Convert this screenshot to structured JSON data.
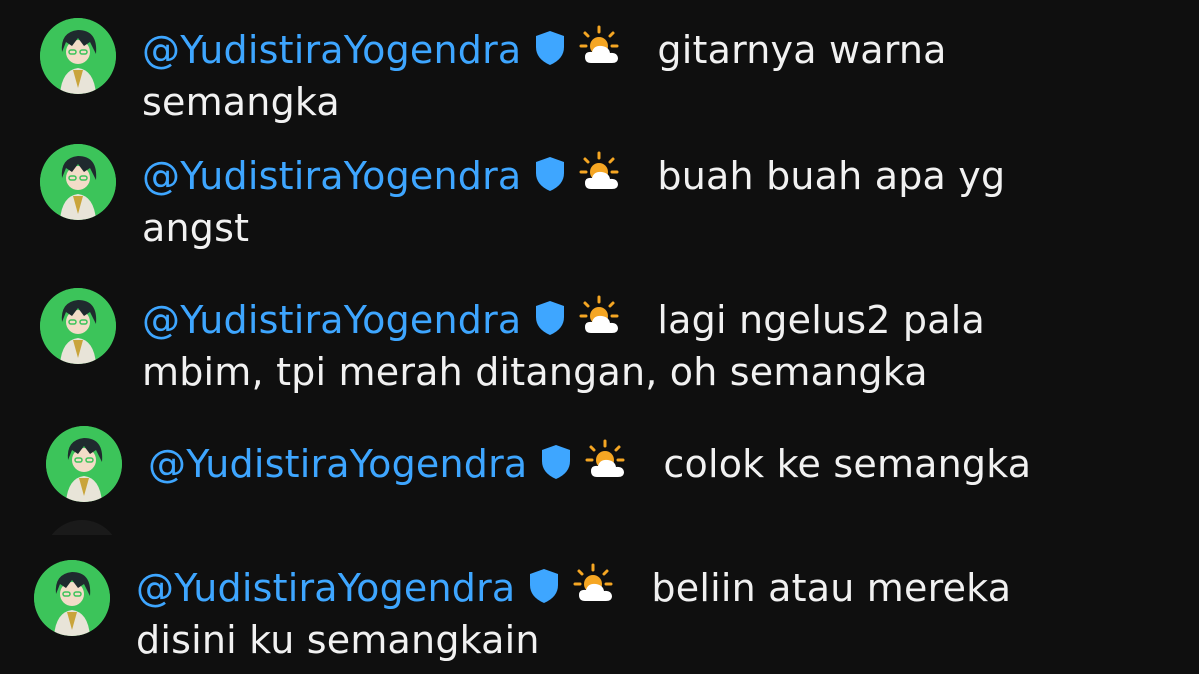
{
  "messages": [
    {
      "author": "@YudistiraYogendra",
      "line1": "gitarnya warna",
      "line2": "semangka"
    },
    {
      "author": "@YudistiraYogendra",
      "line1": "buah buah apa yg",
      "line2": "angst"
    },
    {
      "author": "@YudistiraYogendra",
      "line1": "lagi ngelus2 pala",
      "line2": "mbim, tpi merah ditangan, oh semangka"
    },
    {
      "author": "@YudistiraYogendra",
      "line1": "colok ke semangka",
      "line2": ""
    },
    {
      "author": "@YudistiraYogendra",
      "line1": "beliin atau mereka",
      "line2": "disini ku semangkain"
    }
  ],
  "colors": {
    "background": "#0f0f0f",
    "author": "#3ea6ff",
    "text": "#f1f1f1",
    "avatar_bg": "#3cc45a",
    "badge": "#3ea6ff"
  },
  "icons": {
    "badge": "shield-icon",
    "emoji": "sun-behind-cloud-icon"
  }
}
